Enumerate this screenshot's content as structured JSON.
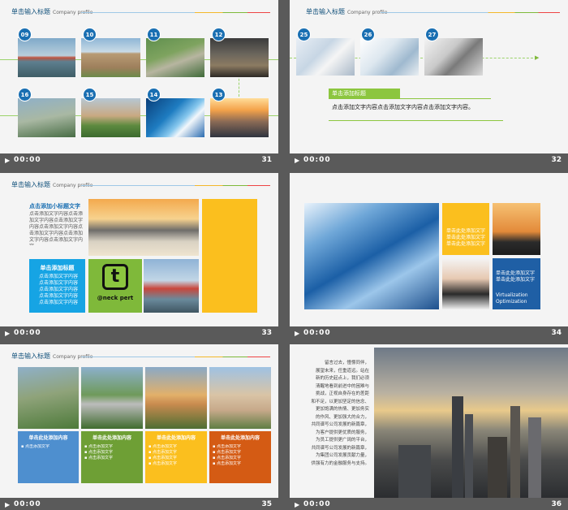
{
  "colors": {
    "blue": "#1a6fb2",
    "sky": "#16a4e4",
    "green": "#7fb93a",
    "yellow": "#fbbf1e",
    "orange": "#d45b14",
    "navy": "#1f5fa5"
  },
  "header": {
    "title": "单击输入标题",
    "subtitle": "Company profile"
  },
  "meta": {
    "time": "00:00"
  },
  "slides": [
    {
      "number": "31",
      "badges": [
        "09",
        "10",
        "11",
        "12",
        "16",
        "15",
        "14",
        "13"
      ]
    },
    {
      "number": "32",
      "badges": [
        "25",
        "26",
        "27"
      ],
      "label": "单击添加标题",
      "body": "点击添加文字内容点击添加文字内容点击添加文字内容。"
    },
    {
      "number": "33",
      "subtitle": "点击添加小标题文字",
      "paragraph": "点击添加文字内容点击添加文字内容点击添加文字内容点击添加文字内容点击添加文字内容点击添加文字内容点击添加文字内容",
      "box_title": "单击添加标题",
      "box_lines": [
        "点击添加文字内容",
        "点击添加文字内容",
        "点击添加文字内容",
        "点击添加文字内容",
        "点击添加文字内容"
      ],
      "logo_text": "@neck pert"
    },
    {
      "number": "34",
      "yellow_lines": [
        "单击此处添加文字",
        "单击此处添加文字",
        "单击此处添加文字"
      ],
      "blue_lines": [
        "单击此处添加文字",
        "单击此处添加文字"
      ],
      "en_lines": [
        "Virtualization",
        "Optimization"
      ]
    },
    {
      "number": "35",
      "captions": [
        "单击此处添加内容",
        "单击此处添加内容",
        "单击此处添加内容",
        "单击此处添加内容"
      ],
      "bullets": [
        "点击添加文字",
        "点击添加文字",
        "点击添加文字",
        "点击添加文字"
      ]
    },
    {
      "number": "36",
      "lines": [
        "留言过去，憧憬同伴，",
        "展望未来，任重道远。站在",
        "新的历史起点上，我们必须",
        "清醒地看到前进中的困难与",
        "挑战，正视自身存在的差距",
        "和不足，以更加坚定的信念、",
        "更加饱满的热情、更加务实",
        "的作风、更加强大的合力，",
        "共同谱写公司发展的新篇章，",
        "为客户提供更优质的服务，",
        "为员工提供更广阔的平台，",
        "共同谱写公司发展的新篇章，",
        "为集团公司发展贡献力量，",
        "供强有力的金融服务与支持。"
      ]
    }
  ]
}
